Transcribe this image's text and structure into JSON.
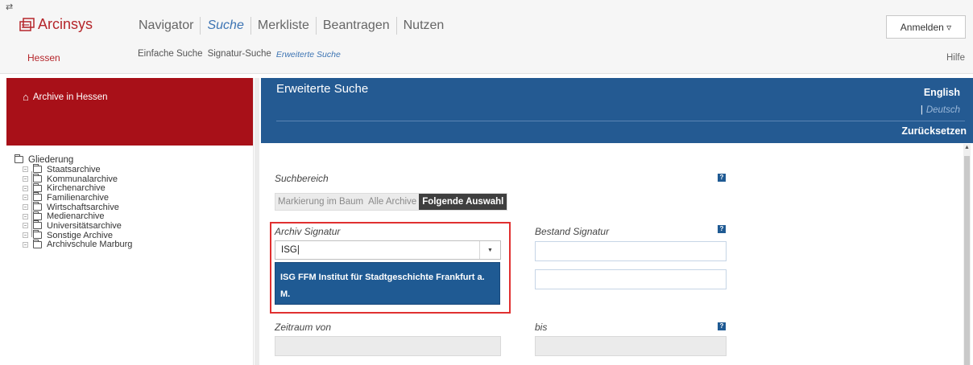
{
  "app": {
    "logo_text": "Arcinsys",
    "region": "Hessen",
    "swap_icon": "⇄"
  },
  "nav": {
    "main": [
      "Navigator",
      "Suche",
      "Merkliste",
      "Beantragen",
      "Nutzen"
    ],
    "active_main": "Suche",
    "sub": [
      "Einfache Suche",
      "Signatur-Suche",
      "Erweiterte Suche"
    ],
    "active_sub": "Erweiterte Suche",
    "login": "Anmelden ▿",
    "help": "Hilfe"
  },
  "sidebar": {
    "header_link": "Archive in Hessen",
    "tree_root": "Gliederung",
    "items": [
      "Staatsarchive",
      "Kommunalarchive",
      "Kirchenarchive",
      "Familienarchive",
      "Wirtschaftsarchive",
      "Medienarchive",
      "Universitätsarchive",
      "Sonstige Archive",
      "Archivschule Marburg"
    ]
  },
  "main": {
    "title": "Erweiterte Suche",
    "lang_en": "English",
    "lang_de": "Deutsch",
    "reset": "Zurücksetzen",
    "search_area_label": "Suchbereich",
    "search_area_options": [
      "Markierung im Baum",
      "Alle Archive",
      "Folgende Auswahl"
    ],
    "search_area_selected": "Folgende Auswahl",
    "archive_signatur_label": "Archiv Signatur",
    "archive_signatur_value": "ISG",
    "archive_suggestion": "ISG FFM Institut für Stadtgeschichte Frankfurt a. M.",
    "bestand_signatur_label": "Bestand Signatur",
    "zeitraum_von_label": "Zeitraum von",
    "bis_label": "bis",
    "help_marker": "?"
  },
  "colors": {
    "brand_red": "#a81018",
    "header_blue": "#245a92",
    "link_blue": "#3d74b3",
    "highlight_red": "#e03030"
  }
}
